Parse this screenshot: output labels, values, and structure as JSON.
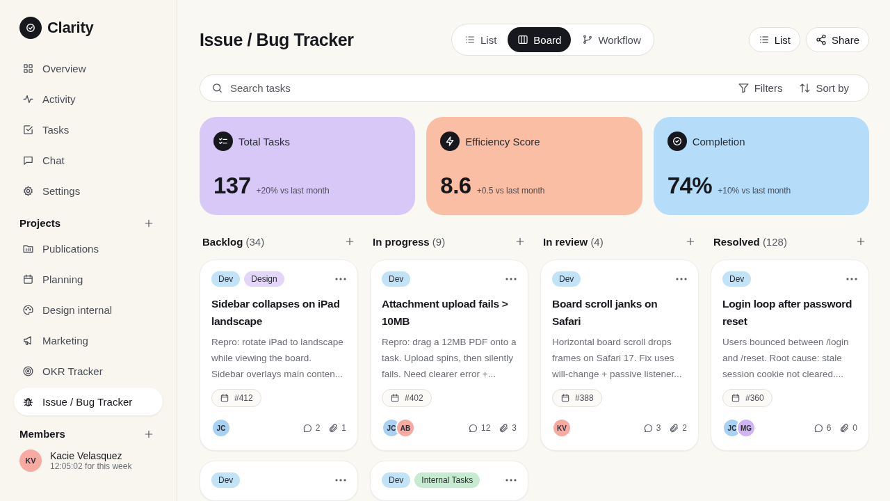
{
  "app": {
    "name": "Clarity"
  },
  "nav": [
    {
      "label": "Overview",
      "selected": false
    },
    {
      "label": "Activity",
      "selected": false
    },
    {
      "label": "Tasks",
      "selected": false
    },
    {
      "label": "Chat",
      "selected": false
    },
    {
      "label": "Settings",
      "selected": false
    }
  ],
  "projects": {
    "title": "Projects",
    "items": [
      {
        "label": "Publications",
        "selected": false
      },
      {
        "label": "Planning",
        "selected": false
      },
      {
        "label": "Design internal",
        "selected": false
      },
      {
        "label": "Marketing",
        "selected": false
      },
      {
        "label": "OKR Tracker",
        "selected": false
      },
      {
        "label": "Issue / Bug Tracker",
        "selected": true
      }
    ]
  },
  "members": {
    "title": "Members",
    "items": [
      {
        "initials": "KV",
        "name": "Kacie Velasquez",
        "time": "12:05:02 for this week",
        "color": "#f6aaa2"
      }
    ]
  },
  "page": {
    "title": "Issue / Bug Tracker"
  },
  "views": [
    {
      "label": "List",
      "selected": false
    },
    {
      "label": "Board",
      "selected": true
    },
    {
      "label": "Workflow",
      "selected": false
    }
  ],
  "actions": [
    "List",
    "Share"
  ],
  "search": {
    "placeholder": "Search tasks"
  },
  "tools": [
    "Filters",
    "Sort by"
  ],
  "stats": [
    {
      "label": "Total Tasks",
      "value": "137",
      "delta": "+20% vs last month",
      "color": "#d8c8f7"
    },
    {
      "label": "Efficiency Score",
      "value": "8.6",
      "delta": "+0.5 vs last month",
      "color": "#f9bea3"
    },
    {
      "label": "Completion",
      "value": "74%",
      "delta": "+10% vs last month",
      "color": "#b5dcf8"
    }
  ],
  "columns": [
    {
      "title": "Backlog",
      "count": "(34)",
      "cards": [
        {
          "tags": [
            {
              "label": "Dev",
              "color": "#c2e2f8"
            },
            {
              "label": "Design",
              "color": "#e3d6f9"
            }
          ],
          "title": "Sidebar collapses on iPad landscape",
          "text": "Repro: rotate iPad to landscape while viewing the board. Sidebar overlays main conten...",
          "id": "#412",
          "avatars": [
            {
              "initials": "JC",
              "color": "#a8d1f2"
            }
          ],
          "comments": "2",
          "attachments": "1"
        },
        {
          "tags": [
            {
              "label": "Dev",
              "color": "#c2e2f8"
            }
          ]
        }
      ]
    },
    {
      "title": "In progress",
      "count": "(9)",
      "cards": [
        {
          "tags": [
            {
              "label": "Dev",
              "color": "#c2e2f8"
            }
          ],
          "title": "Attachment upload fails > 10MB",
          "text": "Repro: drag a 12MB PDF onto a task. Upload spins, then silently fails. Need clearer error +...",
          "id": "#402",
          "avatars": [
            {
              "initials": "JC",
              "color": "#a8d1f2"
            },
            {
              "initials": "AB",
              "color": "#f6aaa2"
            }
          ],
          "comments": "12",
          "attachments": "3"
        },
        {
          "tags": [
            {
              "label": "Dev",
              "color": "#c2e2f8"
            },
            {
              "label": "Internal Tasks",
              "color": "#c6ebd1"
            }
          ]
        }
      ]
    },
    {
      "title": "In review",
      "count": "(4)",
      "cards": [
        {
          "tags": [
            {
              "label": "Dev",
              "color": "#c2e2f8"
            }
          ],
          "title": "Board scroll janks on Safari",
          "text": "Horizontal board scroll drops frames on Safari 17. Fix uses will-change + passive listener...",
          "id": "#388",
          "avatars": [
            {
              "initials": "KV",
              "color": "#f6aaa2"
            }
          ],
          "comments": "3",
          "attachments": "2"
        }
      ]
    },
    {
      "title": "Resolved",
      "count": "(128)",
      "cards": [
        {
          "tags": [
            {
              "label": "Dev",
              "color": "#c2e2f8"
            }
          ],
          "title": "Login loop after password reset",
          "text": "Users bounced between /login and /reset. Root cause: stale session cookie not cleared....",
          "id": "#360",
          "avatars": [
            {
              "initials": "JC",
              "color": "#a8d1f2"
            },
            {
              "initials": "MG",
              "color": "#cfb5f1"
            }
          ],
          "comments": "6",
          "attachments": "0"
        }
      ]
    }
  ]
}
